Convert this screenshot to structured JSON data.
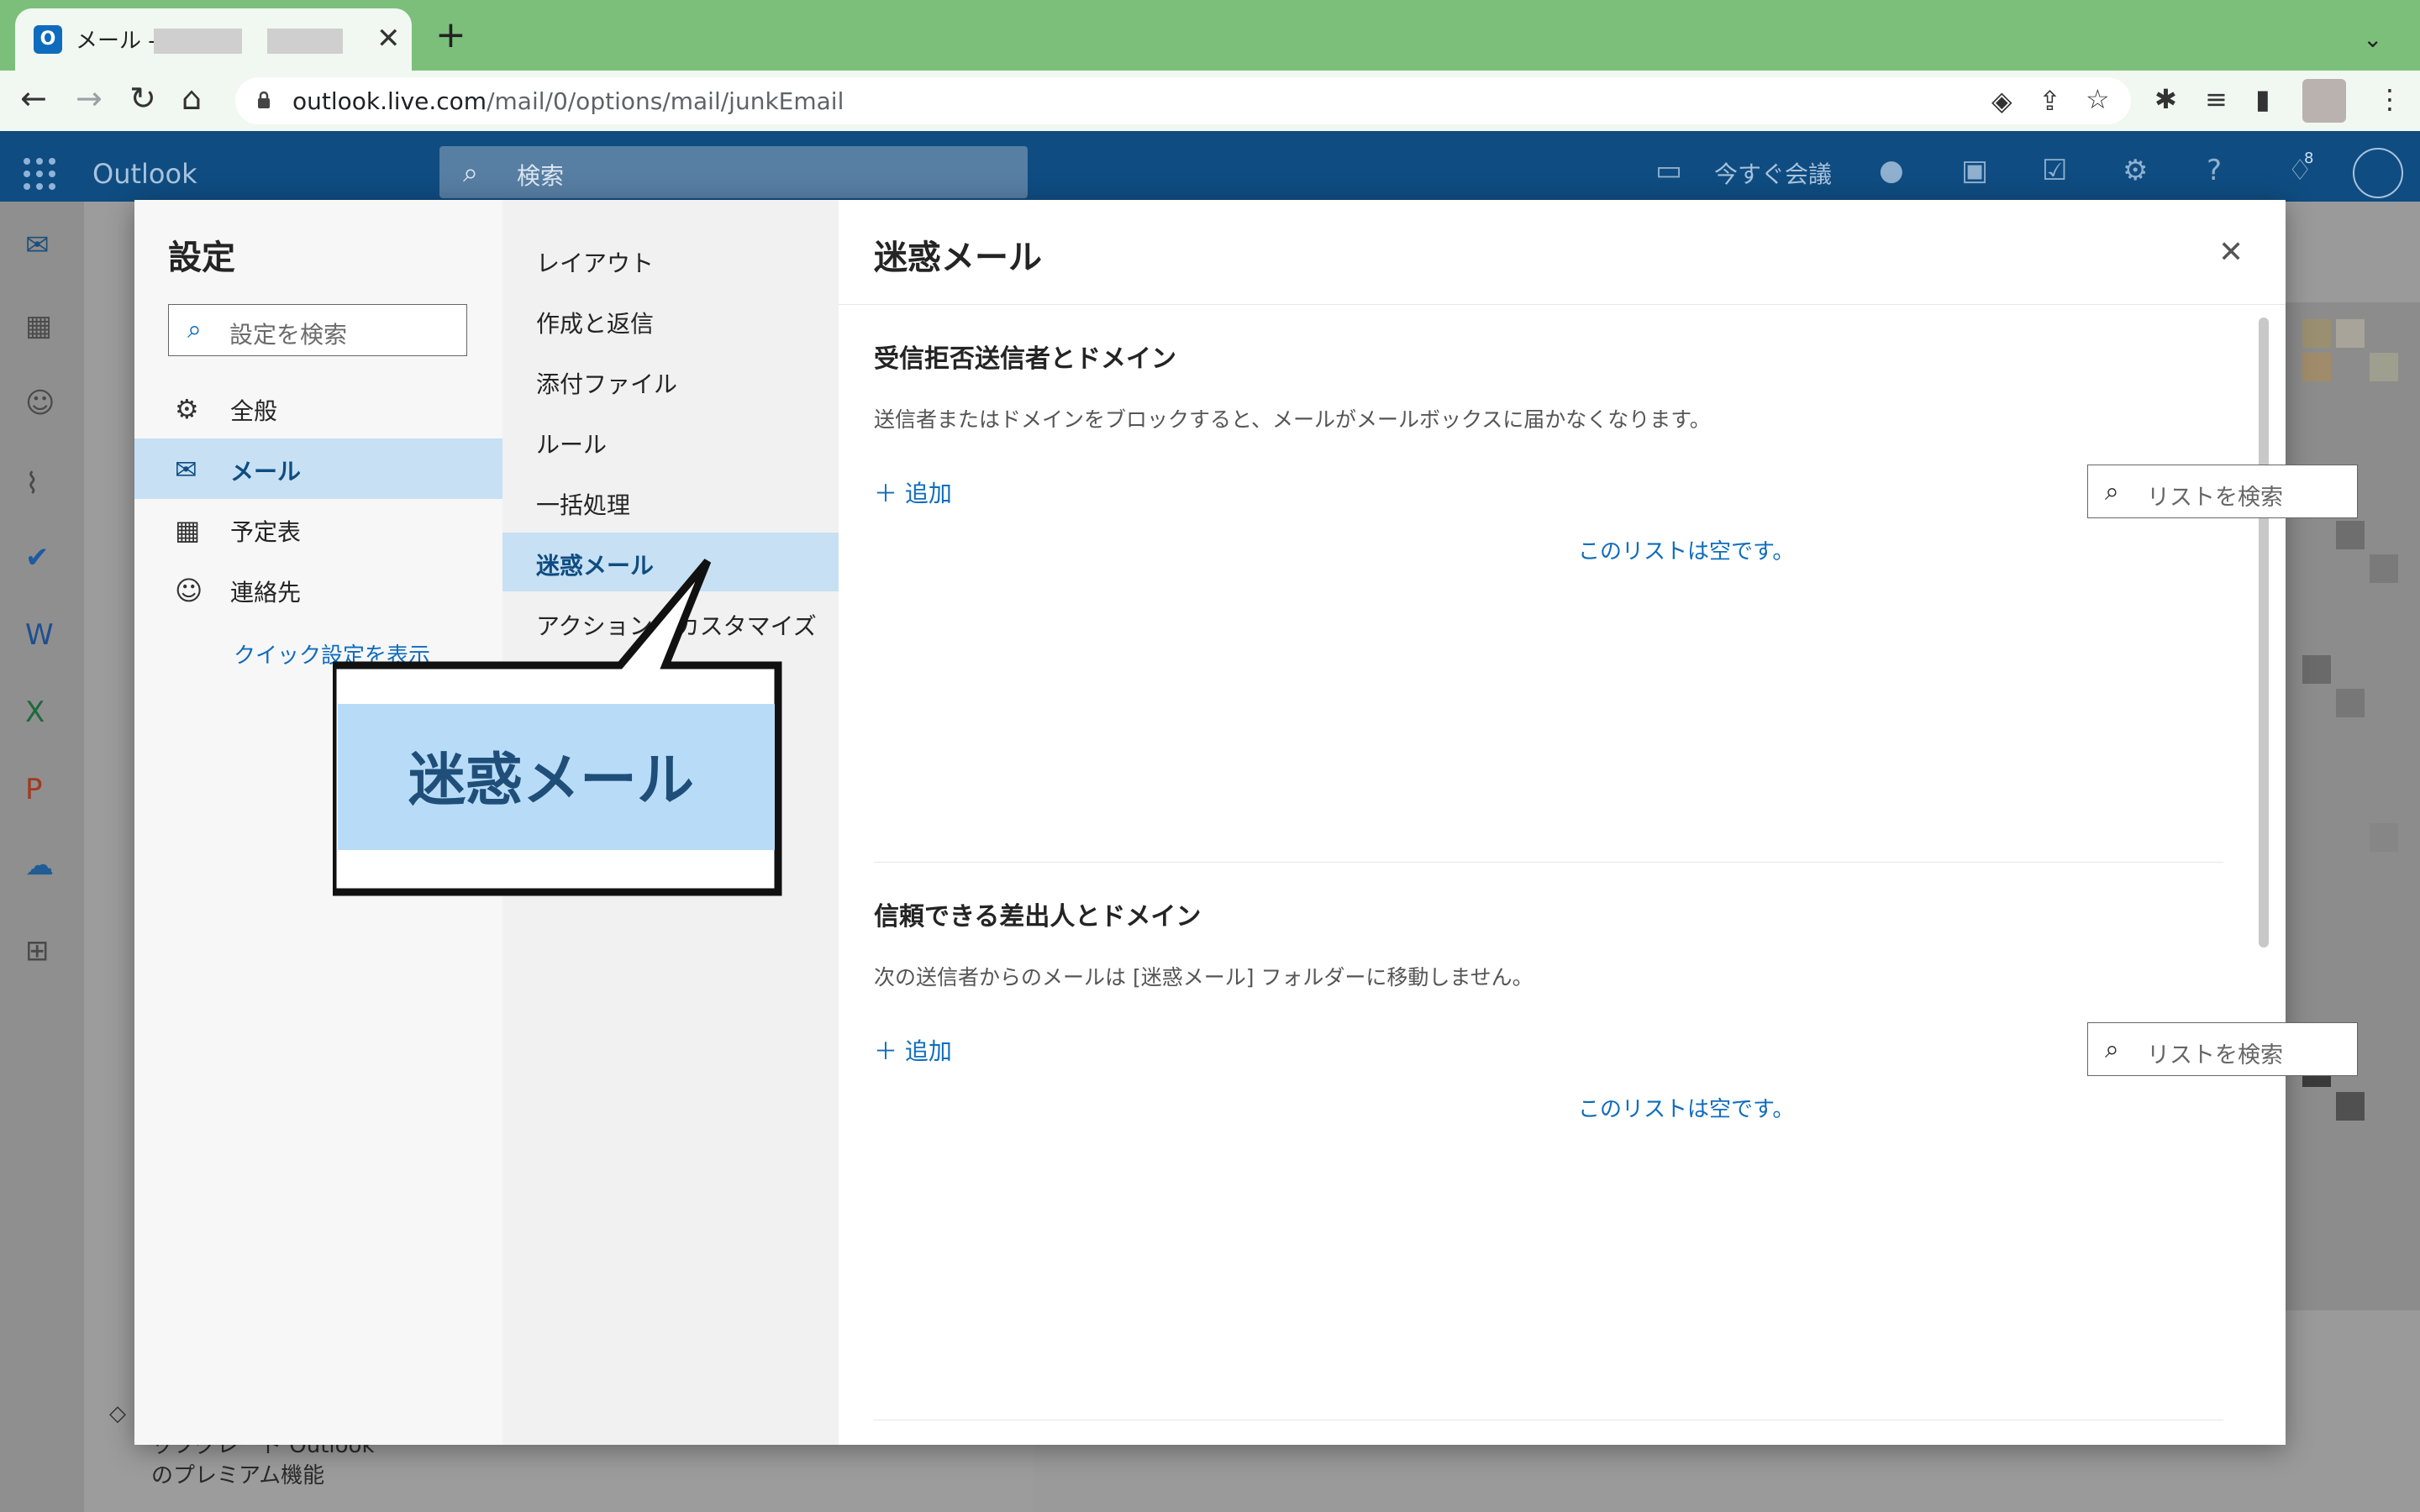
{
  "browser": {
    "tab_title": "メール -",
    "tab_close": "✕",
    "new_tab": "+",
    "url_host": "outlook.live.com",
    "url_path": "/mail/0/options/mail/junkEmail"
  },
  "outlook": {
    "brand": "Outlook",
    "search_placeholder": "検索",
    "meet_now": "今すぐ会議",
    "notification_count": "8"
  },
  "background": {
    "upgrade_line1": "ップグレード Outlook",
    "upgrade_line2": "のプレミアム機能"
  },
  "settings": {
    "title": "設定",
    "search_placeholder": "設定を検索",
    "categories": [
      {
        "label": "全般",
        "icon": "gear-icon"
      },
      {
        "label": "メール",
        "icon": "mail-icon",
        "selected": true
      },
      {
        "label": "予定表",
        "icon": "calendar-icon"
      },
      {
        "label": "連絡先",
        "icon": "people-icon"
      }
    ],
    "quick_settings": "クイック設定を表示",
    "subcategories": [
      {
        "label": "レイアウト"
      },
      {
        "label": "作成と返信"
      },
      {
        "label": "添付ファイル"
      },
      {
        "label": "ルール"
      },
      {
        "label": "一括処理"
      },
      {
        "label": "迷惑メール",
        "selected": true
      },
      {
        "label": "アクションのカスタマイズ"
      }
    ],
    "content": {
      "title": "迷惑メール",
      "blocked": {
        "title": "受信拒否送信者とドメイン",
        "description": "送信者またはドメインをブロックすると、メールがメールボックスに届かなくなります。",
        "add_label": "追加",
        "search_placeholder": "リストを検索",
        "empty_text": "このリストは空です。"
      },
      "safe": {
        "title": "信頼できる差出人とドメイン",
        "description": "次の送信者からのメールは [迷惑メール] フォルダーに移動しません。",
        "add_label": "追加",
        "search_placeholder": "リストを検索",
        "empty_text": "このリストは空です。"
      }
    }
  },
  "callout": {
    "text": "迷惑メール",
    "fill_color": "#b8dcf8",
    "border_color": "#111111"
  }
}
